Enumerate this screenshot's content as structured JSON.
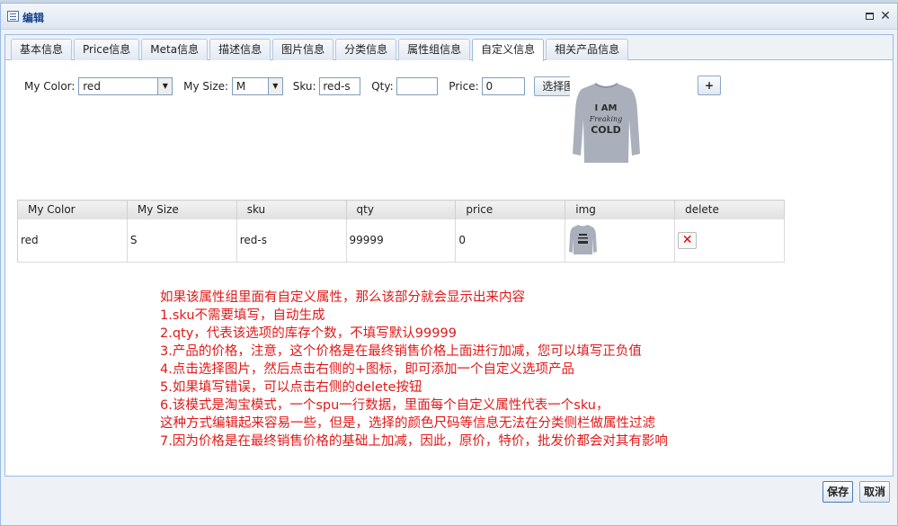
{
  "window": {
    "title": "编辑"
  },
  "tabs": [
    {
      "label": "基本信息"
    },
    {
      "label": "Price信息"
    },
    {
      "label": "Meta信息"
    },
    {
      "label": "描述信息"
    },
    {
      "label": "图片信息"
    },
    {
      "label": "分类信息"
    },
    {
      "label": "属性组信息"
    },
    {
      "label": "自定义信息"
    },
    {
      "label": "相关产品信息"
    }
  ],
  "active_tab": "自定义信息",
  "form": {
    "color_label": "My Color:",
    "color_value": "red",
    "size_label": "My Size:",
    "size_value": "M",
    "sku_label": "Sku:",
    "sku_value": "red-s",
    "qty_label": "Qty:",
    "qty_value": "",
    "price_label": "Price:",
    "price_value": "0",
    "choose_image_label": "选择图片",
    "add_label": "+"
  },
  "sweater": {
    "line1": "I AM",
    "line2": "Freaking",
    "line3": "COLD"
  },
  "table": {
    "headers": [
      "My Color",
      "My Size",
      "sku",
      "qty",
      "price",
      "img",
      "delete"
    ],
    "rows": [
      {
        "color": "red",
        "size": "S",
        "sku": "red-s",
        "qty": "99999",
        "price": "0",
        "delete": "✕"
      }
    ]
  },
  "notes": [
    "如果该属性组里面有自定义属性，那么该部分就会显示出来内容",
    "1.sku不需要填写，自动生成",
    "2.qty，代表该选项的库存个数，不填写默认99999",
    "3.产品的价格，注意，这个价格是在最终销售价格上面进行加减，您可以填写正负值",
    "4.点击选择图片，然后点击右侧的+图标，即可添加一个自定义选项产品",
    "5.如果填写错误，可以点击右侧的delete按钮",
    "6.该模式是淘宝模式，一个spu一行数据，里面每个自定义属性代表一个sku，",
    "这种方式编辑起来容易一些，但是，选择的颜色尺码等信息无法在分类侧栏做属性过滤",
    "7.因为价格是在最终销售价格的基础上加减，因此，原价，特价，批发价都会对其有影响"
  ],
  "footer": {
    "save_label": "保存",
    "cancel_label": "取消"
  },
  "colors": {
    "note_text": "#e01919",
    "title_text": "#15428b",
    "delete_icon": "#dd0000"
  }
}
